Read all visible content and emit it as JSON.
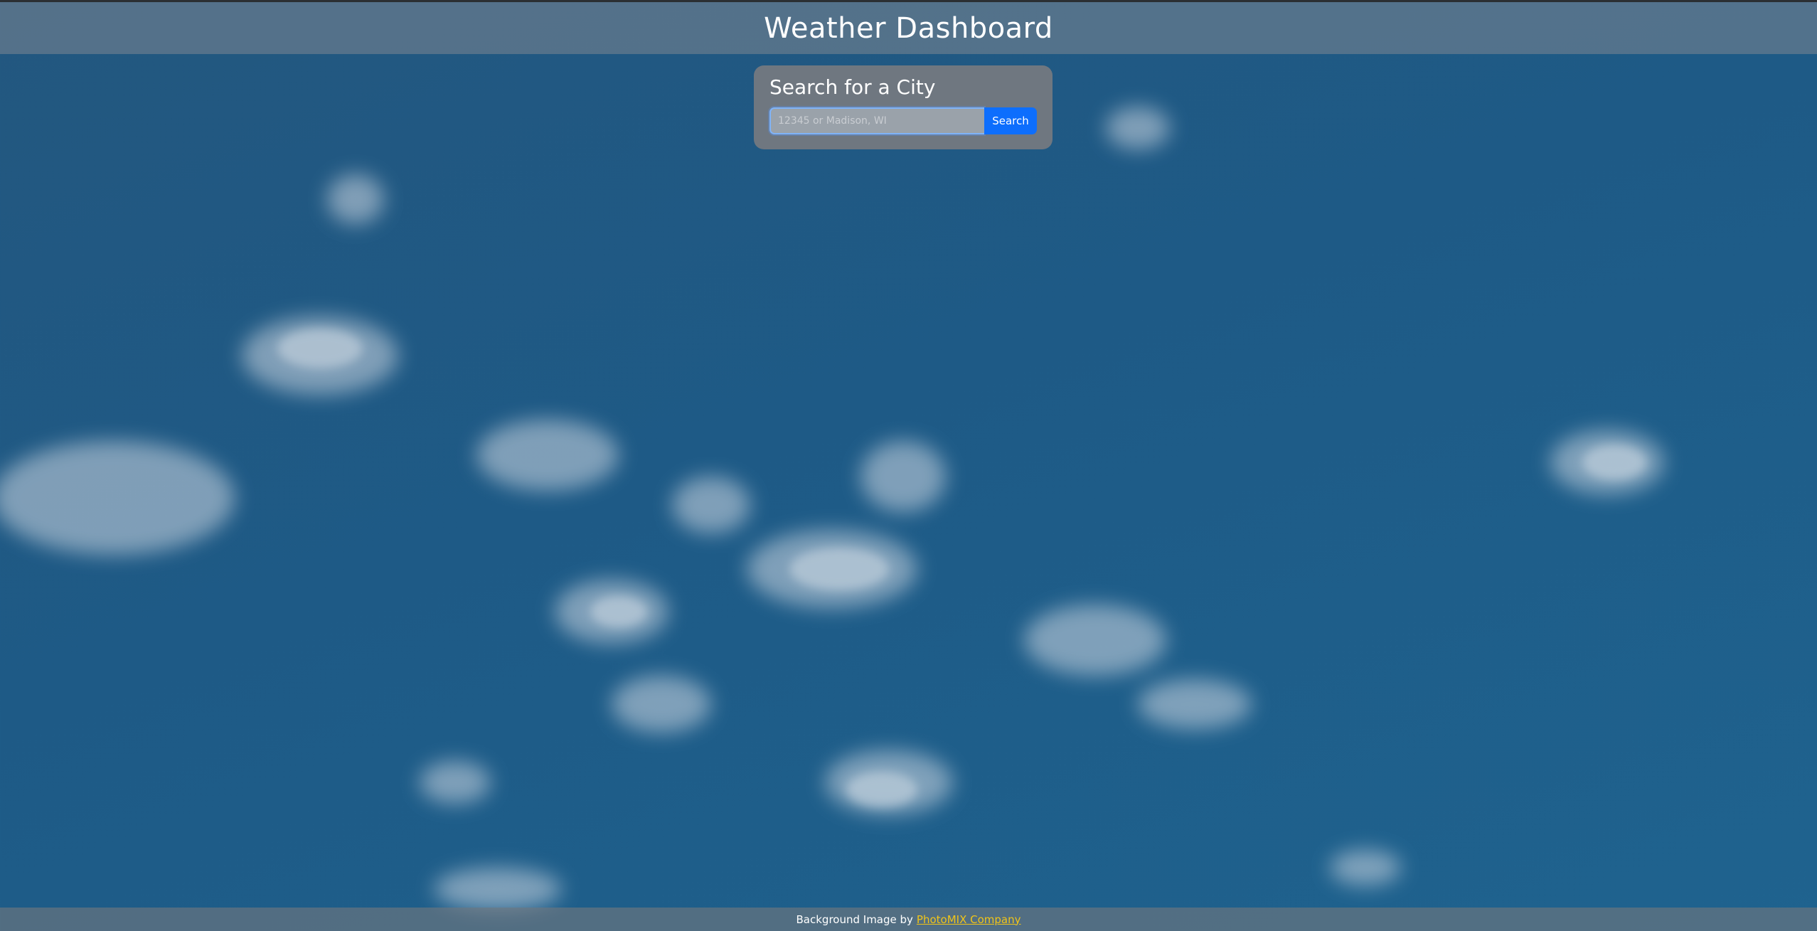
{
  "header": {
    "title": "Weather Dashboard"
  },
  "search": {
    "heading": "Search for a City",
    "placeholder": "12345 or Madison, WI",
    "value": "",
    "button_label": "Search"
  },
  "footer": {
    "credit_prefix": "Background Image by",
    "credit_link": "PhotoMIX Company"
  },
  "colors": {
    "sky": "#1e5a86",
    "button": "#0d6efd",
    "link": "#f0c419"
  }
}
